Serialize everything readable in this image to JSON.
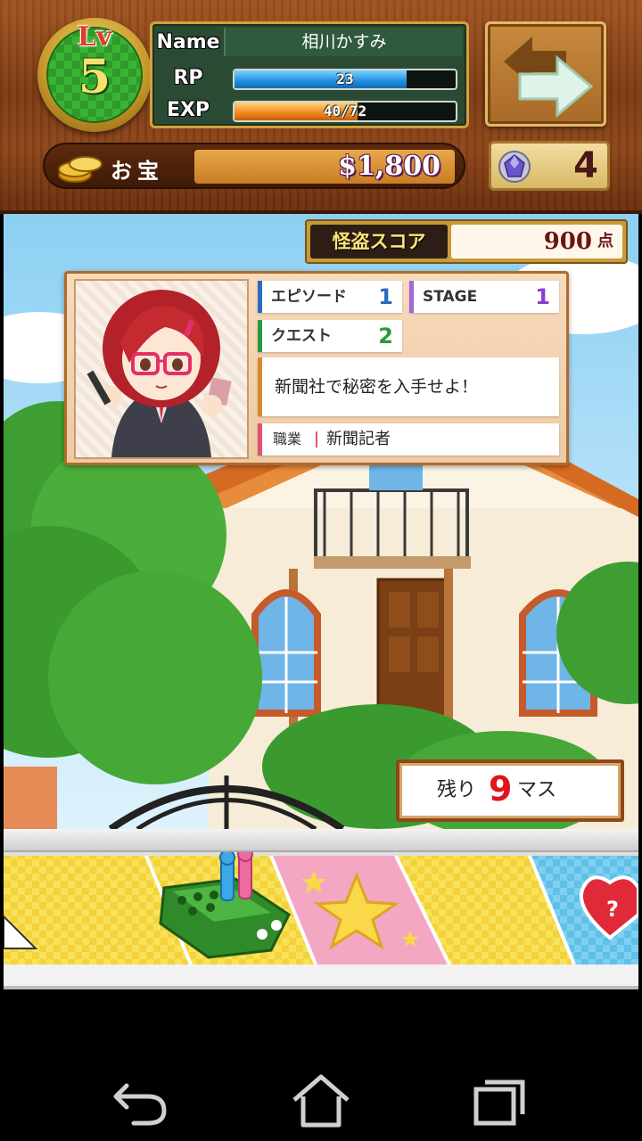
{
  "player": {
    "level_label": "Lv",
    "level": "5",
    "name_label": "Name",
    "name": "相川かすみ",
    "rp_label": "RP",
    "rp_text": "23",
    "rp_fraction": 0.78,
    "exp_label": "EXP",
    "exp_text": "40/72",
    "exp_fraction": 0.556
  },
  "treasure": {
    "label": "お宝",
    "value": "$1,800"
  },
  "gems": {
    "count": "4"
  },
  "score": {
    "label": "怪盗スコア",
    "value": "900",
    "unit": "点"
  },
  "character": {
    "episode_label": "エピソード",
    "episode_value": "1",
    "stage_label": "STAGE",
    "stage_value": "1",
    "quest_label": "クエスト",
    "quest_value": "2",
    "mission": "新聞社で秘密を入手せよ！",
    "job_label": "職業",
    "job_value": "新聞記者"
  },
  "remaining": {
    "prefix": "残り",
    "count": "9",
    "suffix": "マス"
  },
  "colors": {
    "episode_accent": "#2c6ac1",
    "stage_accent": "#a368d8",
    "quest_accent": "#2a9a3a",
    "remaining_number": "#e0141f"
  },
  "icons": {
    "level_badge": "level-badge-icon",
    "arrow": "swap-arrow-icon",
    "coin": "coin-stack-icon",
    "gem": "gem-icon",
    "back": "back-icon",
    "home": "home-icon",
    "recent": "recent-apps-icon"
  }
}
